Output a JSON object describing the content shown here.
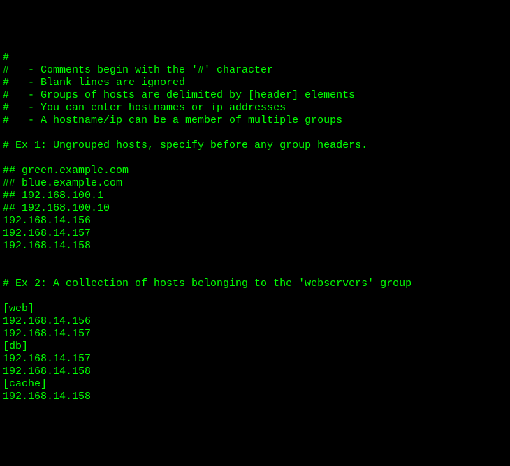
{
  "lines": [
    "#",
    "#   - Comments begin with the '#' character",
    "#   - Blank lines are ignored",
    "#   - Groups of hosts are delimited by [header] elements",
    "#   - You can enter hostnames or ip addresses",
    "#   - A hostname/ip can be a member of multiple groups",
    "",
    "# Ex 1: Ungrouped hosts, specify before any group headers.",
    "",
    "## green.example.com",
    "## blue.example.com",
    "## 192.168.100.1",
    "## 192.168.100.10",
    "192.168.14.156",
    "192.168.14.157",
    "192.168.14.158",
    "",
    "",
    "# Ex 2: A collection of hosts belonging to the 'webservers' group",
    "",
    "[web]",
    "192.168.14.156",
    "192.168.14.157",
    "[db]",
    "192.168.14.157",
    "192.168.14.158",
    "[cache]",
    "192.168.14.158"
  ]
}
